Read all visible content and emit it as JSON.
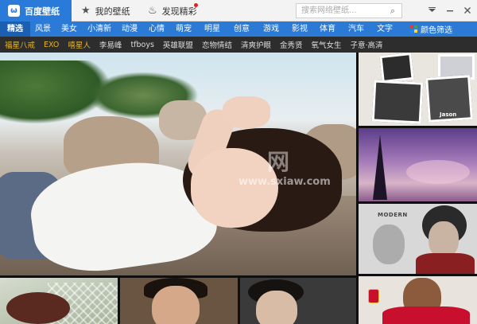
{
  "app": {
    "title": "百度壁纸",
    "tabs": [
      {
        "label": "我的壁纸",
        "icon": "star-icon"
      },
      {
        "label": "发现精彩",
        "icon": "fire-icon"
      }
    ],
    "search": {
      "placeholder": "搜索网络壁纸..."
    },
    "window_buttons": [
      "skin-icon",
      "minimize-icon",
      "close-icon"
    ]
  },
  "categories": [
    "精选",
    "风景",
    "美女",
    "小清新",
    "动漫",
    "心情",
    "萌宠",
    "明星",
    "创意",
    "游戏",
    "影视",
    "体育",
    "汽车",
    "文字"
  ],
  "active_category": "精选",
  "color_filter": {
    "label": "颜色筛选",
    "colors": [
      "#e53935",
      "#43a047",
      "#1e88e5",
      "#fdd835"
    ]
  },
  "tags": [
    {
      "label": "福星八戒",
      "highlight": true
    },
    {
      "label": "EXO",
      "highlight": true
    },
    {
      "label": "嘻星人",
      "highlight": true
    },
    {
      "label": "李易峰",
      "highlight": false
    },
    {
      "label": "tfboys",
      "highlight": false
    },
    {
      "label": "英雄联盟",
      "highlight": false
    },
    {
      "label": "恋物情结",
      "highlight": false
    },
    {
      "label": "清爽护眼",
      "highlight": false
    },
    {
      "label": "金秀贤",
      "highlight": false
    },
    {
      "label": "氧气女生",
      "highlight": false
    },
    {
      "label": "子意·高清",
      "highlight": false
    }
  ],
  "thumbnails": {
    "hero": {
      "watermark": "www.sxiaw.com",
      "watermark_logo": "网"
    },
    "right_top": {
      "caption": "Jason"
    },
    "right_bottom": {
      "caption": "MODERN"
    }
  }
}
